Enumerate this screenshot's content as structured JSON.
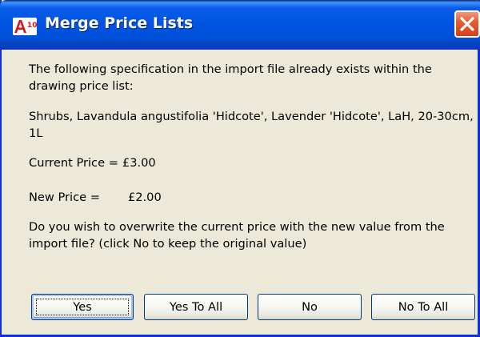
{
  "window": {
    "title": "Merge Price Lists",
    "app_icon": "autocad-a10-icon",
    "close_icon": "close-x-icon"
  },
  "message": {
    "intro": "The following specification in the import file already exists within the drawing price list:",
    "specification": "Shrubs, Lavandula angustifolia 'Hidcote', Lavender 'Hidcote', LaH, 20-30cm, 1L",
    "current_price_label": "Current Price =",
    "current_price_value": "£3.00",
    "new_price_label": "New Price =",
    "new_price_value": "£2.00",
    "question": "Do you wish to overwrite the current price with the new value from the import file? (click No to keep the original value)"
  },
  "buttons": {
    "yes": "Yes",
    "yes_to_all": "Yes To All",
    "no": "No",
    "no_to_all": "No To All"
  },
  "colors": {
    "titlebar": "#0054e3",
    "close_button": "#e65c32",
    "dialog_background": "#ece9d8",
    "button_border": "#003c74"
  }
}
